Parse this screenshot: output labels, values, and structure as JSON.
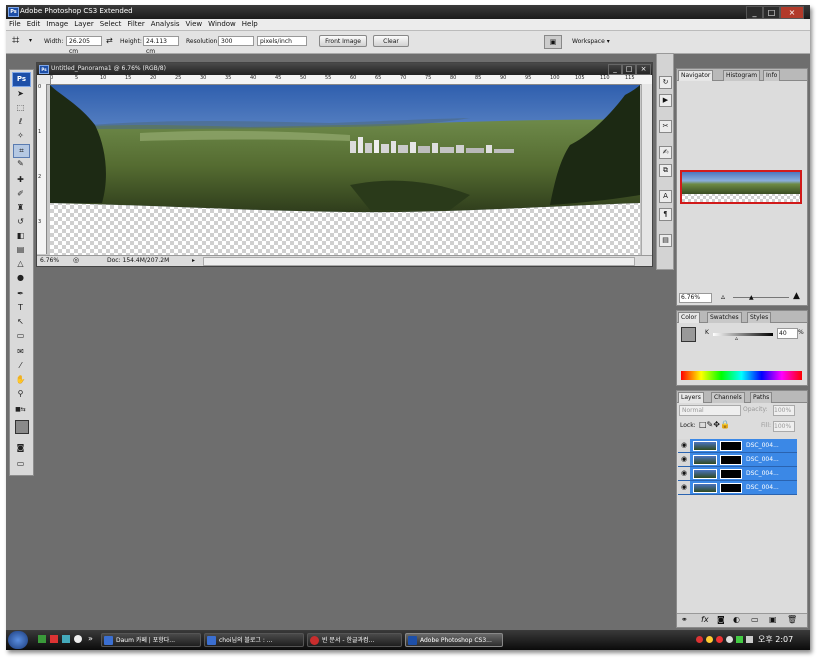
{
  "window": {
    "title": "Adobe Photoshop CS3 Extended",
    "app_icon": "Ps",
    "controls": [
      "_",
      "□",
      "×"
    ]
  },
  "menu": [
    "File",
    "Edit",
    "Image",
    "Layer",
    "Select",
    "Filter",
    "Analysis",
    "View",
    "Window",
    "Help"
  ],
  "options": {
    "width_label": "Width:",
    "width_value": "26.205 cm",
    "height_label": "Height:",
    "height_value": "24.113 cm",
    "resolution_label": "Resolution:",
    "resolution_value": "300",
    "resolution_unit": "pixels/inch",
    "front_image": "Front Image",
    "clear": "Clear",
    "workspace": "Workspace ▾"
  },
  "toolbox": {
    "logo": "Ps",
    "tools": [
      "move-tool",
      "marquee-tool",
      "lasso-tool",
      "magic-wand-tool",
      "crop-tool",
      "slice-tool",
      "healing-brush-tool",
      "brush-tool",
      "clone-stamp-tool",
      "history-brush-tool",
      "eraser-tool",
      "gradient-tool",
      "blur-tool",
      "dodge-tool",
      "pen-tool",
      "type-tool",
      "path-selection-tool",
      "shape-tool",
      "notes-tool",
      "eyedropper-tool",
      "hand-tool",
      "zoom-tool",
      "color-swatches",
      "quick-mask",
      "screen-mode"
    ]
  },
  "document": {
    "title": "Untitled_Panorama1 @ 6.76% (RGB/8)",
    "ruler_ticks": [
      "0",
      "5",
      "10",
      "15",
      "20",
      "25",
      "30",
      "35",
      "40",
      "45",
      "50",
      "55",
      "60",
      "65",
      "70",
      "75",
      "80",
      "85",
      "90",
      "95",
      "100",
      "105",
      "110",
      "115"
    ],
    "ruler_left_ticks": [
      "0",
      "1",
      "2",
      "3"
    ],
    "zoom": "6.76%",
    "doc_size": "Doc: 154.4M/207.2M"
  },
  "navigator": {
    "tabs": [
      "Navigator",
      "Histogram",
      "Info"
    ],
    "zoom": "6.76%"
  },
  "color_panel": {
    "tabs": [
      "Color",
      "Swatches",
      "Styles"
    ],
    "channel": "K",
    "value": "40",
    "unit": "%"
  },
  "layers_panel": {
    "tabs": [
      "Layers",
      "Channels",
      "Paths"
    ],
    "blend_mode": "Normal",
    "opacity_label": "Opacity:",
    "opacity": "100%",
    "lock_label": "Lock:",
    "fill_label": "Fill:",
    "fill": "100%",
    "layers": [
      "DSC_004...",
      "DSC_004...",
      "DSC_004...",
      "DSC_004..."
    ]
  },
  "taskbar": {
    "tasks": [
      "Daum 카페 | 포항다...",
      "choi님의 블로그 : ...",
      "빈 문서 - 한글과컴...",
      "Adobe Photoshop CS3..."
    ],
    "clock": "오후 2:07"
  },
  "colors": {
    "ps_blue": "#1d4fa8",
    "layer_selected": "#3b88e6",
    "workspace_bg": "#6e6e6e",
    "nav_frame": "#d11a1a"
  }
}
